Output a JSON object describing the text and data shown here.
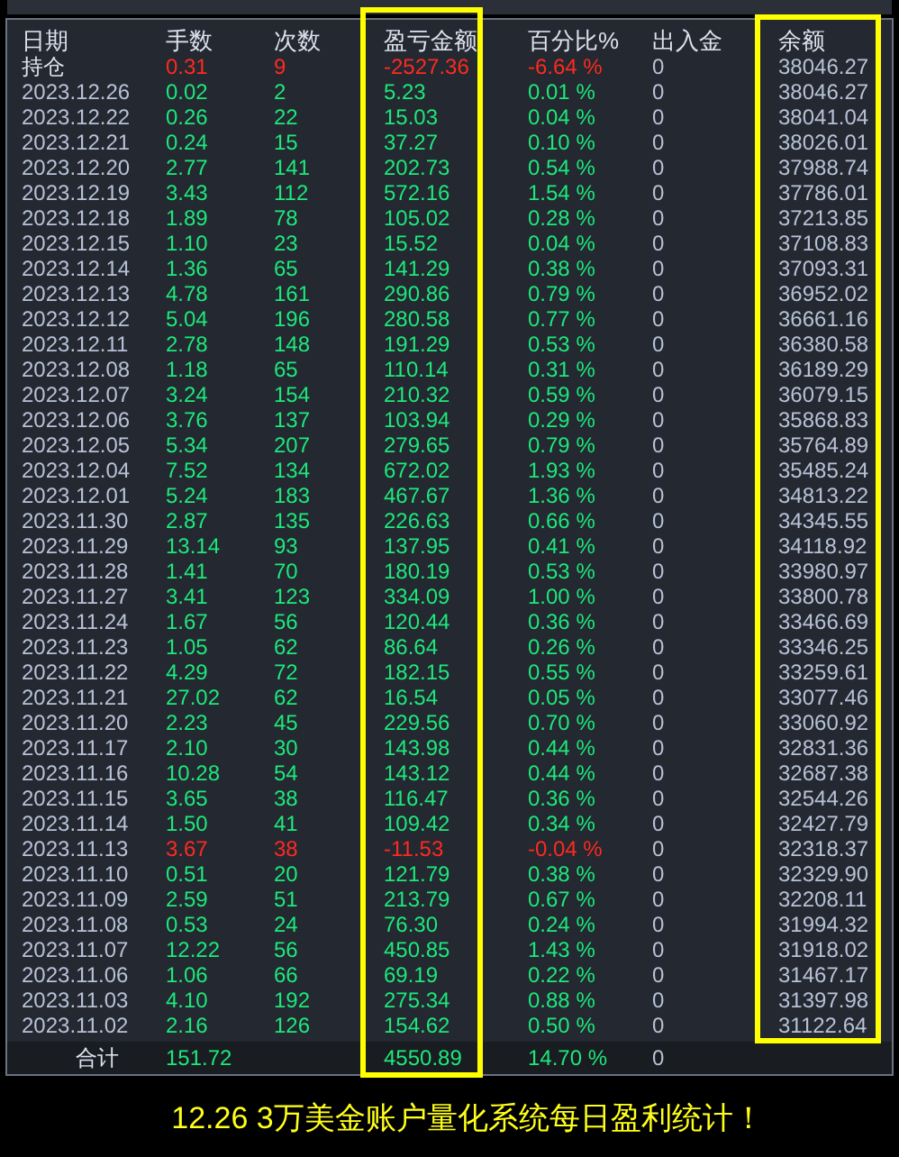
{
  "table": {
    "columns": [
      "日期",
      "手数",
      "次数",
      "盈亏金额",
      "百分比%",
      "出入金",
      "余额"
    ],
    "holding": {
      "label": "持仓",
      "lots": "0.31",
      "trades": "9",
      "pnl": "-2527.36",
      "percent": "-6.64 %",
      "flow": "0",
      "balance": "38046.27",
      "loss": true
    },
    "rows": [
      {
        "date": "2023.12.26",
        "lots": "0.02",
        "trades": "2",
        "pnl": "5.23",
        "percent": "0.01 %",
        "flow": "0",
        "balance": "38046.27",
        "loss": false
      },
      {
        "date": "2023.12.22",
        "lots": "0.26",
        "trades": "22",
        "pnl": "15.03",
        "percent": "0.04 %",
        "flow": "0",
        "balance": "38041.04",
        "loss": false
      },
      {
        "date": "2023.12.21",
        "lots": "0.24",
        "trades": "15",
        "pnl": "37.27",
        "percent": "0.10 %",
        "flow": "0",
        "balance": "38026.01",
        "loss": false
      },
      {
        "date": "2023.12.20",
        "lots": "2.77",
        "trades": "141",
        "pnl": "202.73",
        "percent": "0.54 %",
        "flow": "0",
        "balance": "37988.74",
        "loss": false
      },
      {
        "date": "2023.12.19",
        "lots": "3.43",
        "trades": "112",
        "pnl": "572.16",
        "percent": "1.54 %",
        "flow": "0",
        "balance": "37786.01",
        "loss": false
      },
      {
        "date": "2023.12.18",
        "lots": "1.89",
        "trades": "78",
        "pnl": "105.02",
        "percent": "0.28 %",
        "flow": "0",
        "balance": "37213.85",
        "loss": false
      },
      {
        "date": "2023.12.15",
        "lots": "1.10",
        "trades": "23",
        "pnl": "15.52",
        "percent": "0.04 %",
        "flow": "0",
        "balance": "37108.83",
        "loss": false
      },
      {
        "date": "2023.12.14",
        "lots": "1.36",
        "trades": "65",
        "pnl": "141.29",
        "percent": "0.38 %",
        "flow": "0",
        "balance": "37093.31",
        "loss": false
      },
      {
        "date": "2023.12.13",
        "lots": "4.78",
        "trades": "161",
        "pnl": "290.86",
        "percent": "0.79 %",
        "flow": "0",
        "balance": "36952.02",
        "loss": false
      },
      {
        "date": "2023.12.12",
        "lots": "5.04",
        "trades": "196",
        "pnl": "280.58",
        "percent": "0.77 %",
        "flow": "0",
        "balance": "36661.16",
        "loss": false
      },
      {
        "date": "2023.12.11",
        "lots": "2.78",
        "trades": "148",
        "pnl": "191.29",
        "percent": "0.53 %",
        "flow": "0",
        "balance": "36380.58",
        "loss": false
      },
      {
        "date": "2023.12.08",
        "lots": "1.18",
        "trades": "65",
        "pnl": "110.14",
        "percent": "0.31 %",
        "flow": "0",
        "balance": "36189.29",
        "loss": false
      },
      {
        "date": "2023.12.07",
        "lots": "3.24",
        "trades": "154",
        "pnl": "210.32",
        "percent": "0.59 %",
        "flow": "0",
        "balance": "36079.15",
        "loss": false
      },
      {
        "date": "2023.12.06",
        "lots": "3.76",
        "trades": "137",
        "pnl": "103.94",
        "percent": "0.29 %",
        "flow": "0",
        "balance": "35868.83",
        "loss": false
      },
      {
        "date": "2023.12.05",
        "lots": "5.34",
        "trades": "207",
        "pnl": "279.65",
        "percent": "0.79 %",
        "flow": "0",
        "balance": "35764.89",
        "loss": false
      },
      {
        "date": "2023.12.04",
        "lots": "7.52",
        "trades": "134",
        "pnl": "672.02",
        "percent": "1.93 %",
        "flow": "0",
        "balance": "35485.24",
        "loss": false
      },
      {
        "date": "2023.12.01",
        "lots": "5.24",
        "trades": "183",
        "pnl": "467.67",
        "percent": "1.36 %",
        "flow": "0",
        "balance": "34813.22",
        "loss": false
      },
      {
        "date": "2023.11.30",
        "lots": "2.87",
        "trades": "135",
        "pnl": "226.63",
        "percent": "0.66 %",
        "flow": "0",
        "balance": "34345.55",
        "loss": false
      },
      {
        "date": "2023.11.29",
        "lots": "13.14",
        "trades": "93",
        "pnl": "137.95",
        "percent": "0.41 %",
        "flow": "0",
        "balance": "34118.92",
        "loss": false
      },
      {
        "date": "2023.11.28",
        "lots": "1.41",
        "trades": "70",
        "pnl": "180.19",
        "percent": "0.53 %",
        "flow": "0",
        "balance": "33980.97",
        "loss": false
      },
      {
        "date": "2023.11.27",
        "lots": "3.41",
        "trades": "123",
        "pnl": "334.09",
        "percent": "1.00 %",
        "flow": "0",
        "balance": "33800.78",
        "loss": false
      },
      {
        "date": "2023.11.24",
        "lots": "1.67",
        "trades": "56",
        "pnl": "120.44",
        "percent": "0.36 %",
        "flow": "0",
        "balance": "33466.69",
        "loss": false
      },
      {
        "date": "2023.11.23",
        "lots": "1.05",
        "trades": "62",
        "pnl": "86.64",
        "percent": "0.26 %",
        "flow": "0",
        "balance": "33346.25",
        "loss": false
      },
      {
        "date": "2023.11.22",
        "lots": "4.29",
        "trades": "72",
        "pnl": "182.15",
        "percent": "0.55 %",
        "flow": "0",
        "balance": "33259.61",
        "loss": false
      },
      {
        "date": "2023.11.21",
        "lots": "27.02",
        "trades": "62",
        "pnl": "16.54",
        "percent": "0.05 %",
        "flow": "0",
        "balance": "33077.46",
        "loss": false
      },
      {
        "date": "2023.11.20",
        "lots": "2.23",
        "trades": "45",
        "pnl": "229.56",
        "percent": "0.70 %",
        "flow": "0",
        "balance": "33060.92",
        "loss": false
      },
      {
        "date": "2023.11.17",
        "lots": "2.10",
        "trades": "30",
        "pnl": "143.98",
        "percent": "0.44 %",
        "flow": "0",
        "balance": "32831.36",
        "loss": false
      },
      {
        "date": "2023.11.16",
        "lots": "10.28",
        "trades": "54",
        "pnl": "143.12",
        "percent": "0.44 %",
        "flow": "0",
        "balance": "32687.38",
        "loss": false
      },
      {
        "date": "2023.11.15",
        "lots": "3.65",
        "trades": "38",
        "pnl": "116.47",
        "percent": "0.36 %",
        "flow": "0",
        "balance": "32544.26",
        "loss": false
      },
      {
        "date": "2023.11.14",
        "lots": "1.50",
        "trades": "41",
        "pnl": "109.42",
        "percent": "0.34 %",
        "flow": "0",
        "balance": "32427.79",
        "loss": false
      },
      {
        "date": "2023.11.13",
        "lots": "3.67",
        "trades": "38",
        "pnl": "-11.53",
        "percent": "-0.04 %",
        "flow": "0",
        "balance": "32318.37",
        "loss": true
      },
      {
        "date": "2023.11.10",
        "lots": "0.51",
        "trades": "20",
        "pnl": "121.79",
        "percent": "0.38 %",
        "flow": "0",
        "balance": "32329.90",
        "loss": false
      },
      {
        "date": "2023.11.09",
        "lots": "2.59",
        "trades": "51",
        "pnl": "213.79",
        "percent": "0.67 %",
        "flow": "0",
        "balance": "32208.11",
        "loss": false
      },
      {
        "date": "2023.11.08",
        "lots": "0.53",
        "trades": "24",
        "pnl": "76.30",
        "percent": "0.24 %",
        "flow": "0",
        "balance": "31994.32",
        "loss": false
      },
      {
        "date": "2023.11.07",
        "lots": "12.22",
        "trades": "56",
        "pnl": "450.85",
        "percent": "1.43 %",
        "flow": "0",
        "balance": "31918.02",
        "loss": false
      },
      {
        "date": "2023.11.06",
        "lots": "1.06",
        "trades": "66",
        "pnl": "69.19",
        "percent": "0.22 %",
        "flow": "0",
        "balance": "31467.17",
        "loss": false
      },
      {
        "date": "2023.11.03",
        "lots": "4.10",
        "trades": "192",
        "pnl": "275.34",
        "percent": "0.88 %",
        "flow": "0",
        "balance": "31397.98",
        "loss": false
      },
      {
        "date": "2023.11.02",
        "lots": "2.16",
        "trades": "126",
        "pnl": "154.62",
        "percent": "0.50 %",
        "flow": "0",
        "balance": "31122.64",
        "loss": false
      }
    ],
    "total": {
      "label": "合计",
      "lots": "151.72",
      "pnl": "4550.89",
      "percent": "14.70 %",
      "flow": "0"
    }
  },
  "caption": "12.26 3万美金账户量化系统每日盈利统计！"
}
